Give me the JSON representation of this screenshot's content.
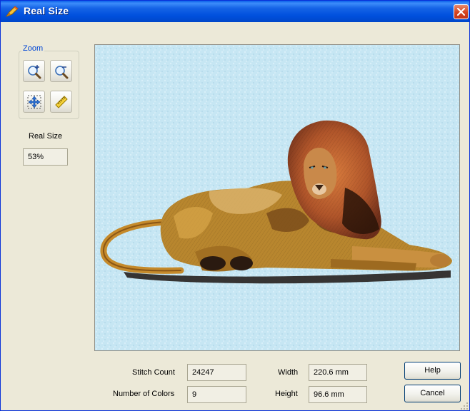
{
  "window": {
    "title": "Real Size"
  },
  "zoom": {
    "legend": "Zoom",
    "tools": [
      {
        "name": "zoom-in"
      },
      {
        "name": "zoom-out"
      },
      {
        "name": "fit-to-window"
      },
      {
        "name": "real-size"
      }
    ]
  },
  "real_size": {
    "label": "Real Size",
    "value": "53%"
  },
  "stats": {
    "stitch_count_label": "Stitch Count",
    "stitch_count": "24247",
    "colors_label": "Number of Colors",
    "colors": "9",
    "width_label": "Width",
    "width": "220.6 mm",
    "height_label": "Height",
    "height": "96.6 mm"
  },
  "buttons": {
    "help": "Help",
    "cancel": "Cancel"
  },
  "colors": {
    "title_bar": "#0050dd",
    "dialog_bg": "#ece9d8",
    "preview_fabric": "#c6e6f3",
    "close_button": "#d5431f"
  }
}
